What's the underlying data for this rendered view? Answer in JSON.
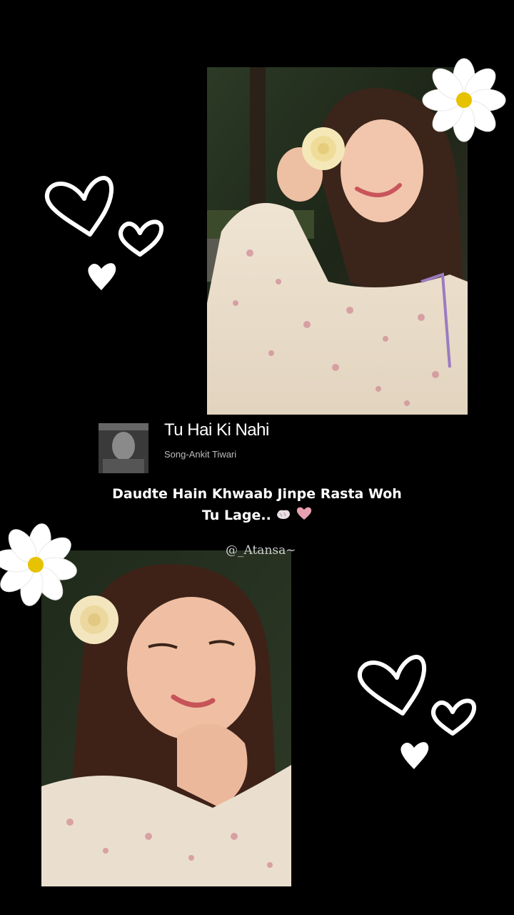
{
  "song": {
    "title": "Tu Hai Ki Nahi",
    "artist": "Song-Ankit Tiwari"
  },
  "lyric": {
    "line1": "Daudte Hain Khwaab Jinpe Rasta Woh",
    "line2": "Tu Lage.."
  },
  "watermark": "@_Atansa~",
  "colors": {
    "background": "#000000",
    "text": "#ffffff",
    "muted": "#bbbbbb",
    "heart_emoji": "#e8a0b0"
  }
}
